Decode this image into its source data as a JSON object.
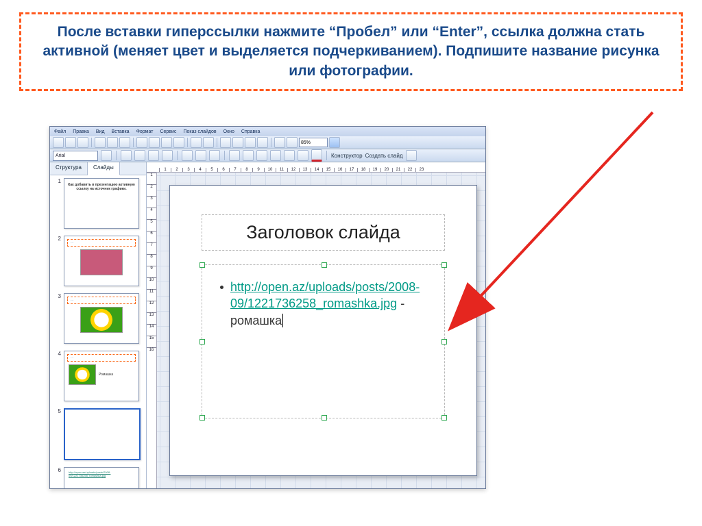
{
  "instruction": "После вставки гиперссылки нажмите “Пробел” или “Enter”, ссылка должна стать активной (меняет цвет и выделяется подчеркиванием). Подпишите название рисунка или фотографии.",
  "app": {
    "menus": [
      "Файл",
      "Правка",
      "Вид",
      "Вставка",
      "Формат",
      "Сервис",
      "Показ слайдов",
      "Окно",
      "Справка"
    ],
    "font_name": "Arial",
    "zoom": "85%",
    "right_buttons": {
      "designer": "Конструктор",
      "new_slide": "Создать слайд"
    },
    "panel_tabs": {
      "structure": "Структура",
      "slides": "Слайды"
    }
  },
  "ruler": {
    "h": [
      "1",
      "2",
      "3",
      "4",
      "5",
      "6",
      "7",
      "8",
      "9",
      "10",
      "11",
      "12",
      "13",
      "14",
      "15",
      "16",
      "17",
      "18",
      "19",
      "20",
      "21",
      "22",
      "23"
    ],
    "v": [
      "1",
      "2",
      "3",
      "4",
      "5",
      "6",
      "7",
      "8",
      "9",
      "10",
      "11",
      "12",
      "13",
      "14",
      "15",
      "16"
    ]
  },
  "thumbnails": [
    {
      "n": "1",
      "kind": "title",
      "title": "Как добавить в презентацию активную ссылку на источник графики."
    },
    {
      "n": "2",
      "kind": "boxed-image-pink"
    },
    {
      "n": "3",
      "kind": "boxed-image-flower"
    },
    {
      "n": "4",
      "kind": "flower-labeled",
      "label": "Ромашка"
    },
    {
      "n": "5",
      "kind": "selected-blank"
    },
    {
      "n": "6",
      "kind": "link-only",
      "link": "http://open.az/uploads/posts/2008-09/1221736258_romashka.jpg"
    }
  ],
  "slide": {
    "title": "Заголовок слайда",
    "link_text": "http://open.az/uploads/posts/2008-09/1221736258_romashka.jpg",
    "caption_after": " - ромашка"
  }
}
